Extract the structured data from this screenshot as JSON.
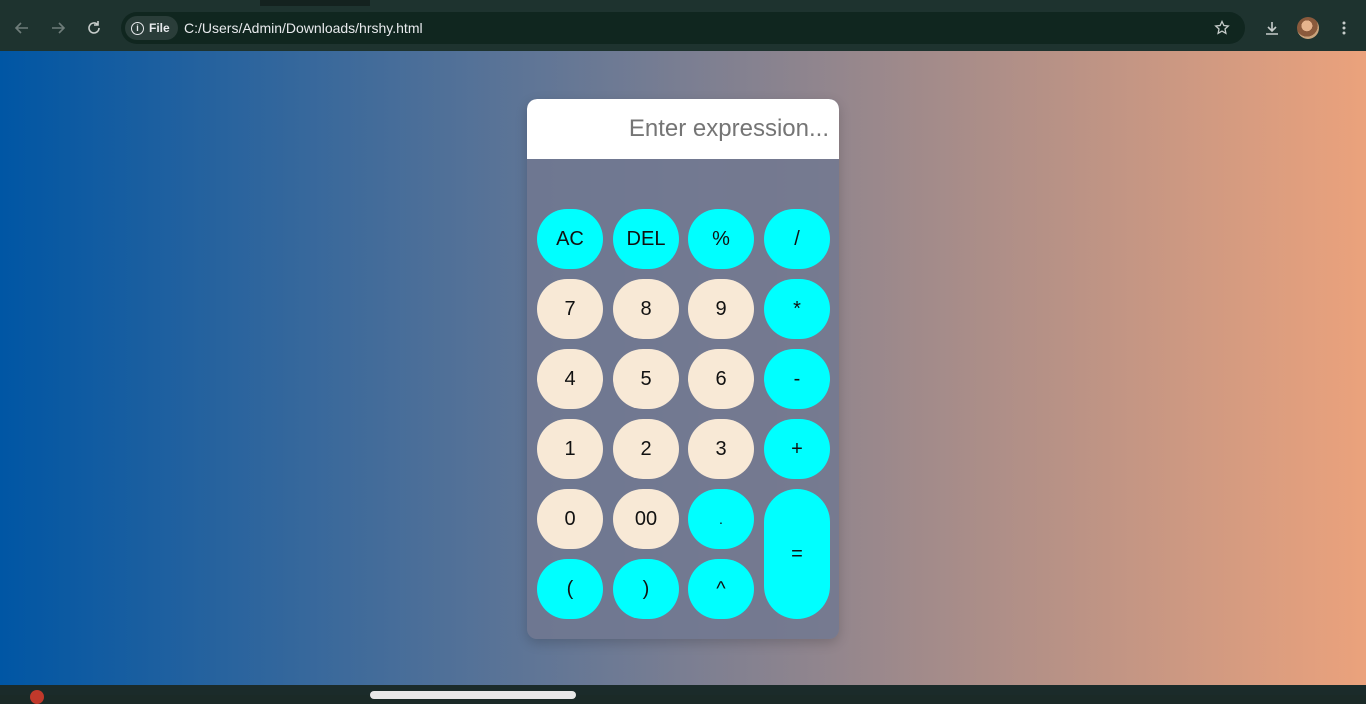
{
  "browser": {
    "url_scheme_label": "File",
    "url": "C:/Users/Admin/Downloads/hrshy.html",
    "icons": [
      "back-icon",
      "forward-icon",
      "reload-icon",
      "info-icon",
      "star-icon",
      "download-icon",
      "avatar",
      "more-icon"
    ]
  },
  "calculator": {
    "input": {
      "value": "",
      "placeholder": "Enter expression..."
    },
    "keys": [
      {
        "label": "AC",
        "type": "op"
      },
      {
        "label": "DEL",
        "type": "op"
      },
      {
        "label": "%",
        "type": "op"
      },
      {
        "label": "/",
        "type": "op"
      },
      {
        "label": "7",
        "type": "num"
      },
      {
        "label": "8",
        "type": "num"
      },
      {
        "label": "9",
        "type": "num"
      },
      {
        "label": "*",
        "type": "op"
      },
      {
        "label": "4",
        "type": "num"
      },
      {
        "label": "5",
        "type": "num"
      },
      {
        "label": "6",
        "type": "num"
      },
      {
        "label": "-",
        "type": "op"
      },
      {
        "label": "1",
        "type": "num"
      },
      {
        "label": "2",
        "type": "num"
      },
      {
        "label": "3",
        "type": "num"
      },
      {
        "label": "+",
        "type": "op"
      },
      {
        "label": "0",
        "type": "num"
      },
      {
        "label": "00",
        "type": "num"
      },
      {
        "label": ".",
        "type": "op"
      },
      {
        "label": "=",
        "type": "op"
      },
      {
        "label": "(",
        "type": "op"
      },
      {
        "label": ")",
        "type": "op"
      },
      {
        "label": "^",
        "type": "op"
      }
    ]
  },
  "colors": {
    "operator_key": "#00ffff",
    "number_key": "#f8e9d6",
    "gradient_start": "#0056a4",
    "gradient_end": "#eba27c"
  }
}
